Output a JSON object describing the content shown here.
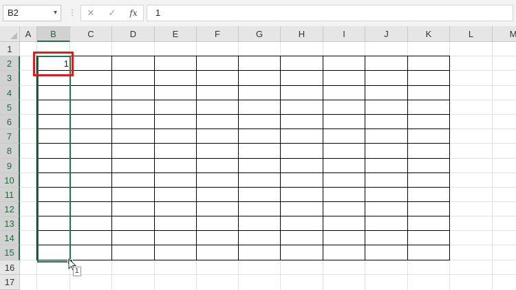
{
  "name_box": {
    "value": "B2",
    "dropdown_icon": "chevron-down-icon"
  },
  "formula_bar": {
    "separator": "⋮",
    "cancel_glyph": "✕",
    "enter_glyph": "✓",
    "function_glyph": "fx",
    "value": "1"
  },
  "columns": [
    "A",
    "B",
    "C",
    "D",
    "E",
    "F",
    "G",
    "H",
    "I",
    "J",
    "K",
    "L",
    "M"
  ],
  "rows": [
    "1",
    "2",
    "3",
    "4",
    "5",
    "6",
    "7",
    "8",
    "9",
    "10",
    "11",
    "12",
    "13",
    "14",
    "15",
    "16",
    "17"
  ],
  "selected_column": "B",
  "active_cell": {
    "ref": "B2",
    "value": "1"
  },
  "selection_range": "B2:B15",
  "autofill_tooltip": "1",
  "colors": {
    "selection_border": "#217346",
    "highlight_box": "#e01b1b",
    "table_border": "#000000"
  }
}
